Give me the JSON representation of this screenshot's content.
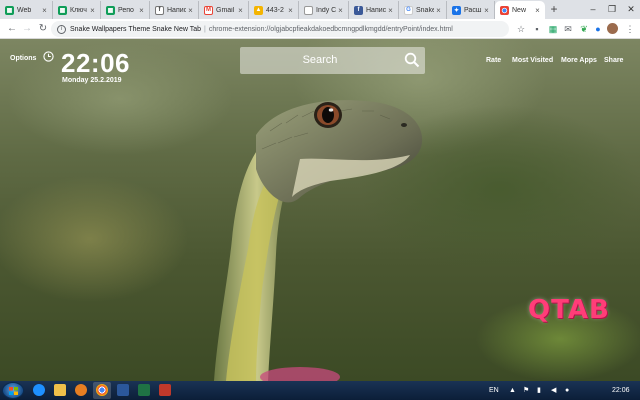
{
  "browser": {
    "tabs": [
      {
        "label": "Web",
        "icon": "sheets-icon",
        "color": "#0f9d58"
      },
      {
        "label": "Ключ",
        "icon": "sheets-icon",
        "color": "#0f9d58"
      },
      {
        "label": "Репо",
        "icon": "sheets-icon",
        "color": "#0f9d58"
      },
      {
        "label": "Напис",
        "icon": "doc-icon",
        "color": "#444444"
      },
      {
        "label": "Gmail",
        "icon": "gmail-icon",
        "color": "#ea4335"
      },
      {
        "label": "443-2",
        "icon": "drive-icon",
        "color": "#f4b400"
      },
      {
        "label": "Indy C",
        "icon": "globe-icon",
        "color": "#777777"
      },
      {
        "label": "Напис",
        "icon": "facebook-icon",
        "color": "#3b5998"
      },
      {
        "label": "Snake",
        "icon": "google-icon",
        "color": "#4285f4"
      },
      {
        "label": "Расши",
        "icon": "puzzle-icon",
        "color": "#1a73e8"
      },
      {
        "label": "New",
        "icon": "chrome-icon",
        "color": "#4285f4"
      }
    ],
    "page_title": "Snake Wallpapers Theme Snake New Tab",
    "url": "chrome-extension://olgjabcpfieakdakoedbcmngpdlkmgdd/entryPoint/index.html"
  },
  "page": {
    "options_label": "Options",
    "time": "22:06",
    "date": "Monday  25.2.2019",
    "search_placeholder": "Search",
    "links": {
      "rate": "Rate",
      "most_visited": "Most Visited",
      "more_apps": "More Apps",
      "share": "Share"
    },
    "brand": "QTAB",
    "brand_color": "#ff3d78"
  },
  "taskbar": {
    "language": "EN",
    "clock": "22:06"
  }
}
